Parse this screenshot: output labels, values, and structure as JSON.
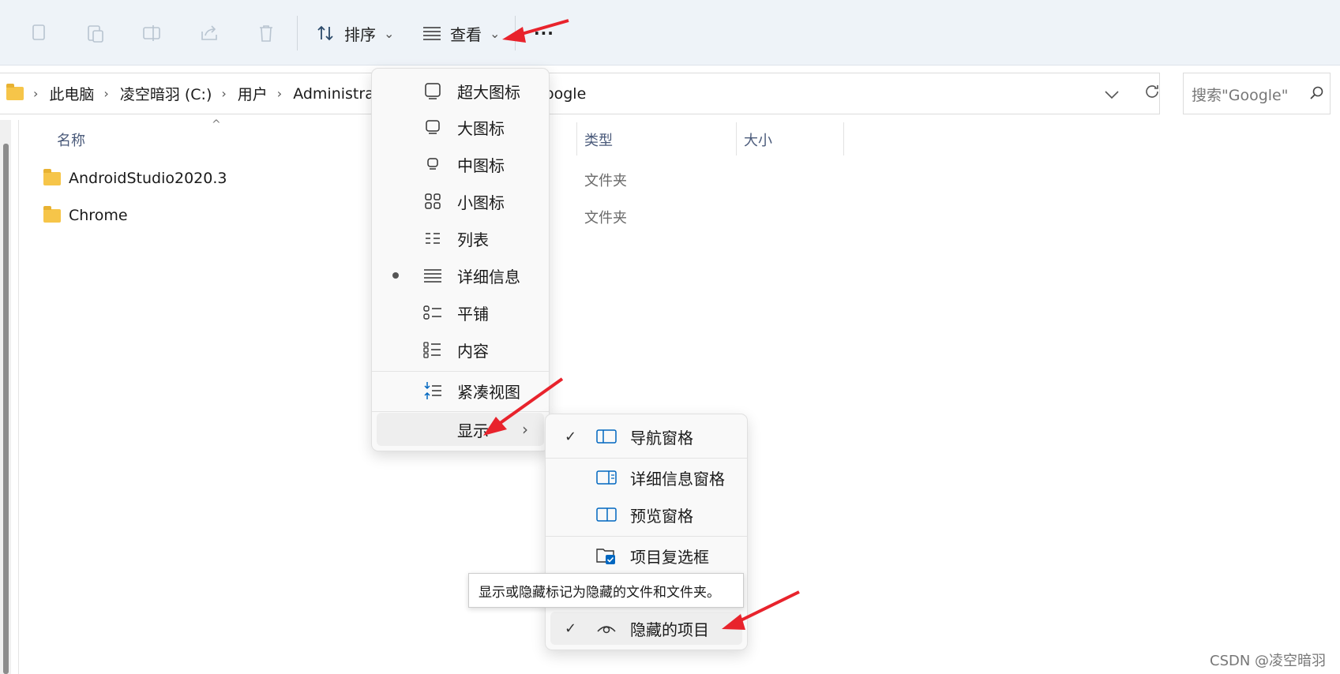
{
  "toolbar": {
    "sort_label": "排序",
    "view_label": "查看",
    "more_label": "···"
  },
  "address": {
    "crumbs": [
      "此电脑",
      "凌空暗羽 (C:)",
      "用户",
      "Administrator"
    ],
    "crumb_tail": "oogle"
  },
  "search": {
    "placeholder": "搜索\"Google\""
  },
  "columns": {
    "name": "名称",
    "type": "类型",
    "size": "大小"
  },
  "rows": [
    {
      "name": "AndroidStudio2020.3",
      "type": "文件夹"
    },
    {
      "name": "Chrome",
      "type": "文件夹"
    }
  ],
  "view_menu": {
    "items": [
      "超大图标",
      "大图标",
      "中图标",
      "小图标",
      "列表",
      "详细信息",
      "平铺",
      "内容"
    ],
    "selected": "详细信息",
    "compact": "紧凑视图",
    "show": "显示"
  },
  "show_menu": {
    "nav_pane": "导航窗格",
    "details_pane": "详细信息窗格",
    "preview_pane": "预览窗格",
    "checkboxes": "项目复选框",
    "hidden_items": "隐藏的项目"
  },
  "tooltip": "显示或隐藏标记为隐藏的文件和文件夹。",
  "watermark": "CSDN @凌空暗羽",
  "colors": {
    "accent": "#0067c0",
    "arrow": "#e8232c",
    "folder": "#f6c549"
  }
}
